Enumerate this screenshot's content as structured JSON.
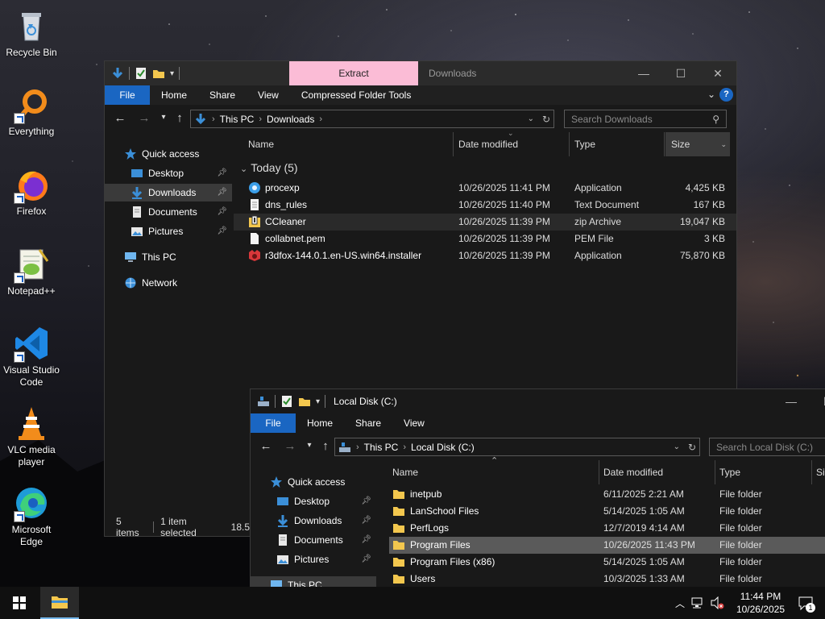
{
  "desktop": {
    "icons": [
      {
        "label": "Recycle Bin"
      },
      {
        "label": "Everything"
      },
      {
        "label": "Firefox"
      },
      {
        "label": "Notepad++"
      },
      {
        "label": "Visual Studio Code"
      },
      {
        "label": "VLC media player"
      },
      {
        "label": "Microsoft Edge"
      }
    ]
  },
  "downloads_window": {
    "context_tab": "Extract",
    "title": "Downloads",
    "tabs": [
      "File",
      "Home",
      "Share",
      "View",
      "Compressed Folder Tools"
    ],
    "breadcrumb": [
      "This PC",
      "Downloads"
    ],
    "search_placeholder": "Search Downloads",
    "nav": [
      {
        "label": "Quick access",
        "icon": "star-icon"
      },
      {
        "label": "Desktop",
        "icon": "desktop-icon",
        "pinned": true
      },
      {
        "label": "Downloads",
        "icon": "download-arrow-icon",
        "pinned": true,
        "selected": true
      },
      {
        "label": "Documents",
        "icon": "document-icon",
        "pinned": true
      },
      {
        "label": "Pictures",
        "icon": "pictures-icon",
        "pinned": true
      },
      {
        "label": "This PC",
        "icon": "computer-icon"
      },
      {
        "label": "Network",
        "icon": "network-icon"
      }
    ],
    "columns": [
      "Name",
      "Date modified",
      "Type",
      "Size"
    ],
    "group_label": "Today (5)",
    "files": [
      {
        "name": "procexp",
        "date": "10/26/2025 11:41 PM",
        "type": "Application",
        "size": "4,425 KB",
        "icon": "procexp-icon"
      },
      {
        "name": "dns_rules",
        "date": "10/26/2025 11:40 PM",
        "type": "Text Document",
        "size": "167 KB",
        "icon": "text-file-icon"
      },
      {
        "name": "CCleaner",
        "date": "10/26/2025 11:39 PM",
        "type": "zip Archive",
        "size": "19,047 KB",
        "icon": "zip-icon"
      },
      {
        "name": "collabnet.pem",
        "date": "10/26/2025 11:39 PM",
        "type": "PEM File",
        "size": "3 KB",
        "icon": "blank-file-icon"
      },
      {
        "name": "r3dfox-144.0.1.en-US.win64.installer",
        "date": "10/26/2025 11:39 PM",
        "type": "Application",
        "size": "75,870 KB",
        "icon": "r3dfox-icon"
      }
    ],
    "status_items": "5 items",
    "status_selected": "1 item selected",
    "status_size": "18.5"
  },
  "c_window": {
    "title": "Local Disk (C:)",
    "tabs": [
      "File",
      "Home",
      "Share",
      "View"
    ],
    "breadcrumb": [
      "This PC",
      "Local Disk (C:)"
    ],
    "search_placeholder": "Search Local Disk (C:)",
    "nav": [
      {
        "label": "Quick access",
        "icon": "star-icon"
      },
      {
        "label": "Desktop",
        "icon": "desktop-icon",
        "pinned": true
      },
      {
        "label": "Downloads",
        "icon": "download-arrow-icon",
        "pinned": true
      },
      {
        "label": "Documents",
        "icon": "document-icon",
        "pinned": true
      },
      {
        "label": "Pictures",
        "icon": "pictures-icon",
        "pinned": true
      },
      {
        "label": "This PC",
        "icon": "computer-icon"
      }
    ],
    "columns": [
      "Name",
      "Date modified",
      "Type",
      "Si"
    ],
    "folders": [
      {
        "name": "inetpub",
        "date": "6/11/2025 2:21 AM",
        "type": "File folder"
      },
      {
        "name": "LanSchool Files",
        "date": "5/14/2025 1:05 AM",
        "type": "File folder"
      },
      {
        "name": "PerfLogs",
        "date": "12/7/2019 4:14 AM",
        "type": "File folder"
      },
      {
        "name": "Program Files",
        "date": "10/26/2025 11:43 PM",
        "type": "File folder",
        "selected": true
      },
      {
        "name": "Program Files (x86)",
        "date": "5/14/2025 1:05 AM",
        "type": "File folder"
      },
      {
        "name": "Users",
        "date": "10/3/2025 1:33 AM",
        "type": "File folder"
      }
    ]
  },
  "taskbar": {
    "time": "11:44 PM",
    "date": "10/26/2025",
    "notification_count": "1"
  },
  "colors": {
    "accent": "#1a66c2",
    "extract_tab": "#fbbcd6",
    "folder": "#f3c74e"
  }
}
